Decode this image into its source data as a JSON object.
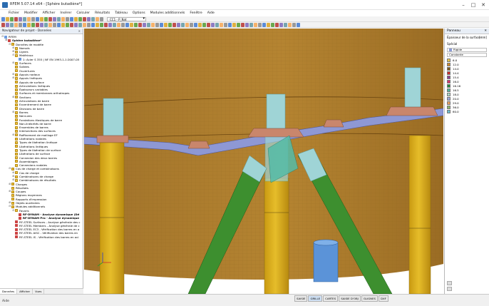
{
  "window": {
    "title": "RFEM 5.07.14 x64 - [Sphère butadiène*]",
    "minimize_glyph": "–",
    "maximize_glyph": "□",
    "close_glyph": "✕"
  },
  "menu": [
    "Fichier",
    "Modifier",
    "Afficher",
    "Insérer",
    "Calculer",
    "Résultats",
    "Tableau",
    "Options",
    "Modules additionnels",
    "Fenêtre",
    "Aide"
  ],
  "toolbar": {
    "loadcase_value": "CC1 - P_Nat"
  },
  "navigator": {
    "title": "Navigateur de projet - Données",
    "pins": "✕",
    "tabs": [
      "Données",
      "Afficher",
      "Vues"
    ],
    "items": [
      {
        "level": 0,
        "toggle": "⊟",
        "icon": "doc",
        "label": "RFEM",
        "bold": false
      },
      {
        "level": 1,
        "toggle": "⊟",
        "icon": "mod",
        "label": "Sphère butadiène*",
        "bold": true
      },
      {
        "level": 2,
        "toggle": "⊟",
        "icon": "folder",
        "label": "Données de modèle",
        "bold": false
      },
      {
        "level": 3,
        "toggle": "⊞",
        "icon": "folder",
        "label": "Noeuds",
        "bold": false
      },
      {
        "level": 3,
        "toggle": "⊞",
        "icon": "folder",
        "label": "Lignes",
        "bold": false
      },
      {
        "level": 3,
        "toggle": "⊟",
        "icon": "folder",
        "label": "Matériaux",
        "bold": false
      },
      {
        "level": 4,
        "toggle": "",
        "icon": "doc",
        "label": "1: Acier S 355 | NF EN 1993-1-1:2007-05",
        "bold": false
      },
      {
        "level": 3,
        "toggle": "⊞",
        "icon": "folder",
        "label": "Surfaces",
        "bold": false
      },
      {
        "level": 3,
        "toggle": "",
        "icon": "folder",
        "label": "Solides",
        "bold": false
      },
      {
        "level": 3,
        "toggle": "",
        "icon": "folder",
        "label": "Ouvertures",
        "bold": false
      },
      {
        "level": 3,
        "toggle": "⊞",
        "icon": "folder",
        "label": "Appuis nodaux",
        "bold": false
      },
      {
        "level": 3,
        "toggle": "⊞",
        "icon": "folder",
        "label": "Appuis linéiques",
        "bold": false
      },
      {
        "level": 3,
        "toggle": "",
        "icon": "folder",
        "label": "Appuis de surface",
        "bold": false
      },
      {
        "level": 3,
        "toggle": "",
        "icon": "folder",
        "label": "Articulations linéiques",
        "bold": false
      },
      {
        "level": 3,
        "toggle": "",
        "icon": "folder",
        "label": "Épaisseurs variables",
        "bold": false
      },
      {
        "level": 3,
        "toggle": "",
        "icon": "folder",
        "label": "Surfaces et membranes orthotropes",
        "bold": false
      },
      {
        "level": 3,
        "toggle": "⊞",
        "icon": "folder",
        "label": "Sections",
        "bold": false
      },
      {
        "level": 3,
        "toggle": "",
        "icon": "folder",
        "label": "Articulations de barre",
        "bold": false
      },
      {
        "level": 3,
        "toggle": "",
        "icon": "folder",
        "label": "Excentrement de barre",
        "bold": false
      },
      {
        "level": 3,
        "toggle": "",
        "icon": "folder",
        "label": "Divisions de barre",
        "bold": false
      },
      {
        "level": 3,
        "toggle": "⊞",
        "icon": "folder",
        "label": "Barres",
        "bold": false
      },
      {
        "level": 3,
        "toggle": "",
        "icon": "folder",
        "label": "Nervures",
        "bold": false
      },
      {
        "level": 3,
        "toggle": "",
        "icon": "folder",
        "label": "Fondations élastiques de barre",
        "bold": false
      },
      {
        "level": 3,
        "toggle": "",
        "icon": "folder",
        "label": "Non-linéarités de barre",
        "bold": false
      },
      {
        "level": 3,
        "toggle": "",
        "icon": "folder",
        "label": "Ensembles de barres",
        "bold": false
      },
      {
        "level": 3,
        "toggle": "",
        "icon": "folder",
        "label": "Intersections des surfaces",
        "bold": false
      },
      {
        "level": 3,
        "toggle": "⊞",
        "icon": "folder",
        "label": "Raffinement de maillage EF",
        "bold": false
      },
      {
        "level": 3,
        "toggle": "",
        "icon": "folder",
        "label": "Libérations nodales",
        "bold": false
      },
      {
        "level": 3,
        "toggle": "",
        "icon": "folder",
        "label": "Types de libération linéique",
        "bold": false
      },
      {
        "level": 3,
        "toggle": "",
        "icon": "folder",
        "label": "Libérations linéiques",
        "bold": false
      },
      {
        "level": 3,
        "toggle": "",
        "icon": "folder",
        "label": "Types de libération de surface",
        "bold": false
      },
      {
        "level": 3,
        "toggle": "",
        "icon": "folder",
        "label": "Libérations de surface",
        "bold": false
      },
      {
        "level": 3,
        "toggle": "",
        "icon": "folder",
        "label": "Connexion des deux barres",
        "bold": false
      },
      {
        "level": 3,
        "toggle": "",
        "icon": "folder",
        "label": "Assemblages",
        "bold": false
      },
      {
        "level": 3,
        "toggle": "",
        "icon": "folder",
        "label": "Connexions nodales",
        "bold": false
      },
      {
        "level": 2,
        "toggle": "⊟",
        "icon": "folder",
        "label": "Cas de charge et combinaisons",
        "bold": false
      },
      {
        "level": 3,
        "toggle": "⊞",
        "icon": "folder",
        "label": "Cas de charge",
        "bold": false
      },
      {
        "level": 3,
        "toggle": "⊞",
        "icon": "folder",
        "label": "Combinaisons de charge",
        "bold": false
      },
      {
        "level": 3,
        "toggle": "⊞",
        "icon": "folder",
        "label": "Combinaisons de résultats",
        "bold": false
      },
      {
        "level": 2,
        "toggle": "⊞",
        "icon": "folder",
        "label": "Charges",
        "bold": false
      },
      {
        "level": 2,
        "toggle": "",
        "icon": "folder",
        "label": "Résultats",
        "bold": false
      },
      {
        "level": 2,
        "toggle": "⊞",
        "icon": "folder",
        "label": "Coupes",
        "bold": false
      },
      {
        "level": 2,
        "toggle": "",
        "icon": "folder",
        "label": "Régions moyennes",
        "bold": false
      },
      {
        "level": 2,
        "toggle": "",
        "icon": "folder",
        "label": "Rapports d'impression",
        "bold": false
      },
      {
        "level": 2,
        "toggle": "⊞",
        "icon": "folder",
        "label": "Objets auxiliaires",
        "bold": false
      },
      {
        "level": 2,
        "toggle": "⊟",
        "icon": "folder",
        "label": "Modules additionnels",
        "bold": false
      },
      {
        "level": 3,
        "toggle": "⊟",
        "icon": "folder",
        "label": "Favoris",
        "bold": false
      },
      {
        "level": 4,
        "toggle": "",
        "icon": "mod",
        "label": "RF-DYNAM - Analyse dynamique (Dé",
        "bold": true
      },
      {
        "level": 4,
        "toggle": "",
        "icon": "mod",
        "label": "RF-DYNAM Pro - Analyse dynamique",
        "bold": true
      },
      {
        "level": 3,
        "toggle": "",
        "icon": "mod",
        "label": "RF-STEEL Surfaces - Analyse générale des c",
        "bold": false
      },
      {
        "level": 3,
        "toggle": "",
        "icon": "mod",
        "label": "RF-STEEL Members - Analyse générale de c",
        "bold": false
      },
      {
        "level": 3,
        "toggle": "",
        "icon": "mod",
        "label": "RF-STEEL EC3 - Vérification des barres en a",
        "bold": false
      },
      {
        "level": 3,
        "toggle": "",
        "icon": "mod",
        "label": "RF-STEEL AISC - Vérification des barres en",
        "bold": false
      },
      {
        "level": 3,
        "toggle": "",
        "icon": "mod",
        "label": "RF-STEEL IS - Vérification des barres en aci",
        "bold": false
      }
    ]
  },
  "panel": {
    "title": "Panneau",
    "close": "✕",
    "subtitle": "Épaisseur de la surface",
    "unit": "[mm]",
    "special_label": "Spécial",
    "mode_value": "Rigide",
    "constant_label": "Constante",
    "legend": [
      {
        "value": "6.0",
        "color": "#e9c84a"
      },
      {
        "value": "12.0",
        "color": "#d08a2a"
      },
      {
        "value": "14.0",
        "color": "#7c5a1a"
      },
      {
        "value": "14.4",
        "color": "#cc2b2b"
      },
      {
        "value": "15.4",
        "color": "#8f3f8f"
      },
      {
        "value": "16.0",
        "color": "#d6326a"
      },
      {
        "value": "16.16",
        "color": "#1f8a3a"
      },
      {
        "value": "16.5",
        "color": "#4fb8a0"
      },
      {
        "value": "18.0",
        "color": "#a8d8c8"
      },
      {
        "value": "20.0",
        "color": "#9aa7d8"
      },
      {
        "value": "29.0",
        "color": "#e7a060"
      },
      {
        "value": "36.0",
        "color": "#8ab66e"
      },
      {
        "value": "60.0",
        "color": "#6ec0d0"
      }
    ]
  },
  "statusbar": {
    "text": "Aide",
    "toggles": [
      "SAISIE",
      "GRILLE",
      "CARTES",
      "SAISIE D'OBJ",
      "GLIGNES",
      "DXF"
    ],
    "active": [
      false,
      true,
      false,
      false,
      false,
      false
    ]
  },
  "colors": {
    "sphere": "#b58431",
    "column": "#e6bd2a",
    "column_cap": "#9fd4d6",
    "girder": "#8e98d4",
    "node_plate": "#c9866c",
    "brace": "#3d8f2f",
    "gusset": "#55bca8",
    "pipe": "#5b93d8"
  }
}
